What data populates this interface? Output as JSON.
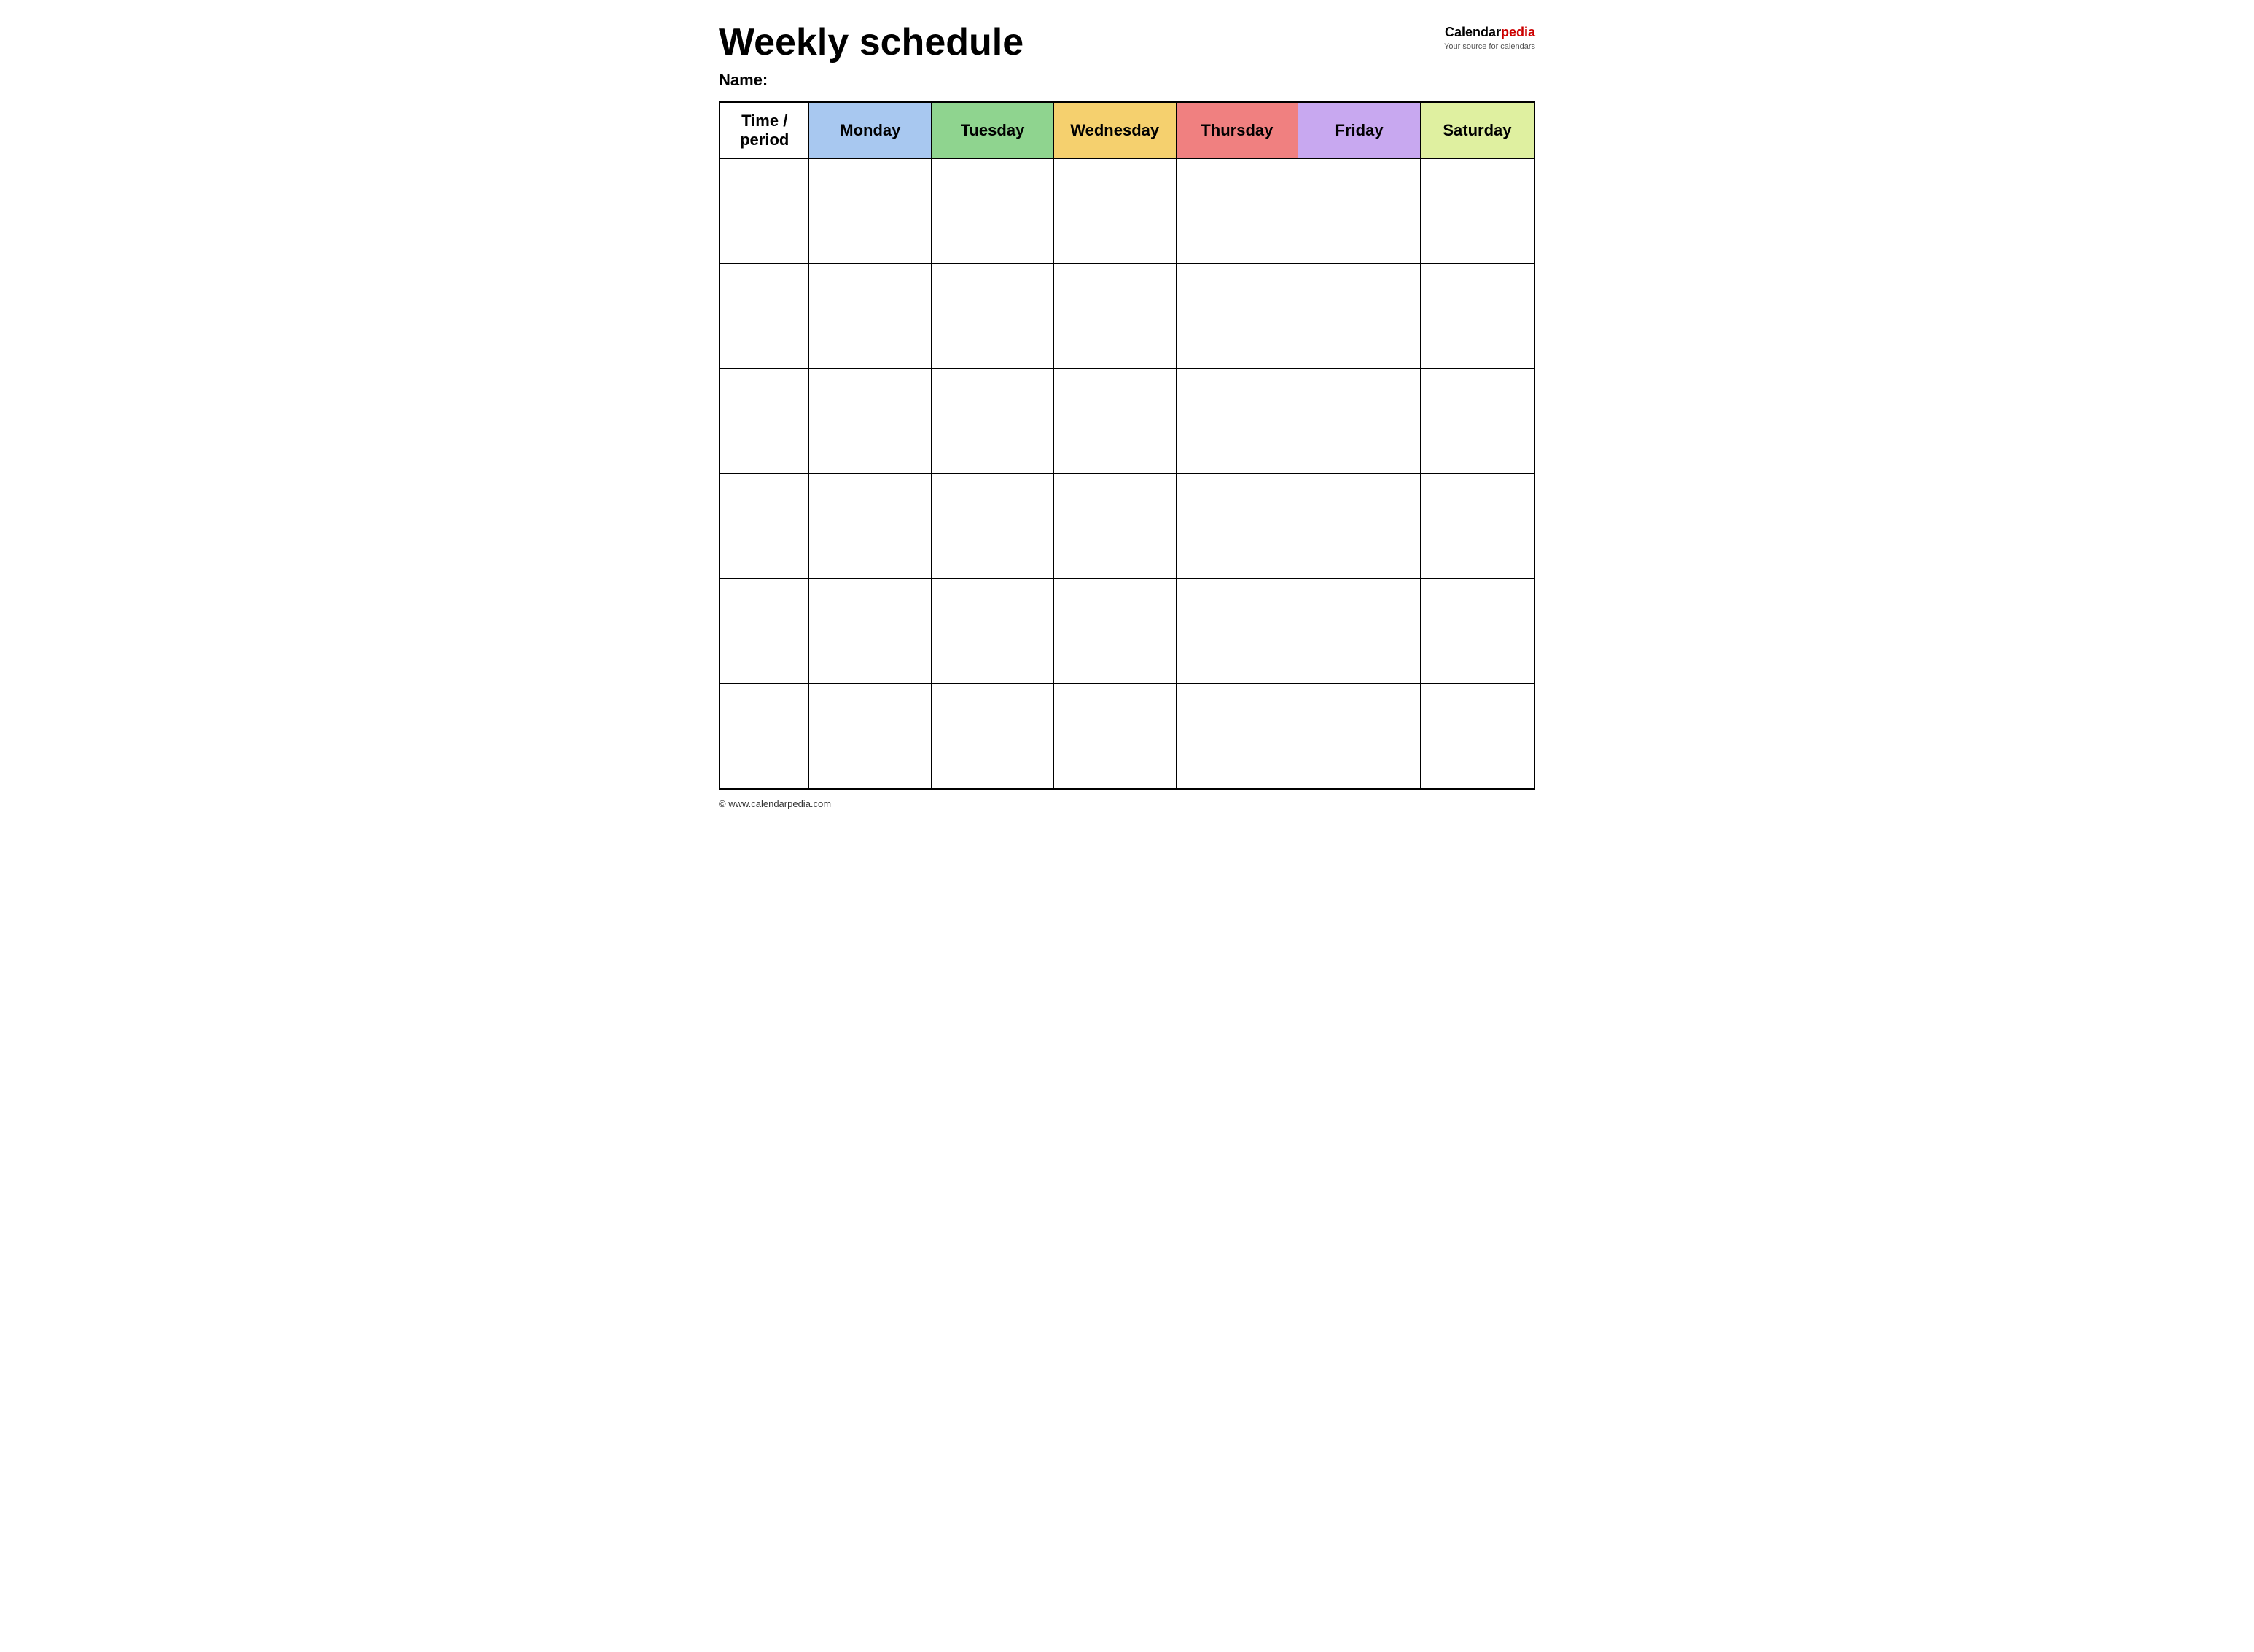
{
  "header": {
    "title": "Weekly schedule",
    "logo": {
      "calendar": "Calendar",
      "pedia": "pedia",
      "tagline": "Your source for calendars"
    },
    "name_label": "Name:"
  },
  "table": {
    "columns": [
      {
        "id": "time",
        "label": "Time / period",
        "color": "#ffffff"
      },
      {
        "id": "monday",
        "label": "Monday",
        "color": "#a8c8f0"
      },
      {
        "id": "tuesday",
        "label": "Tuesday",
        "color": "#8fd48f"
      },
      {
        "id": "wednesday",
        "label": "Wednesday",
        "color": "#f5d06e"
      },
      {
        "id": "thursday",
        "label": "Thursday",
        "color": "#f08080"
      },
      {
        "id": "friday",
        "label": "Friday",
        "color": "#c8a8f0"
      },
      {
        "id": "saturday",
        "label": "Saturday",
        "color": "#dff0a0"
      }
    ],
    "row_count": 12
  },
  "footer": {
    "url": "© www.calendarpedia.com"
  }
}
